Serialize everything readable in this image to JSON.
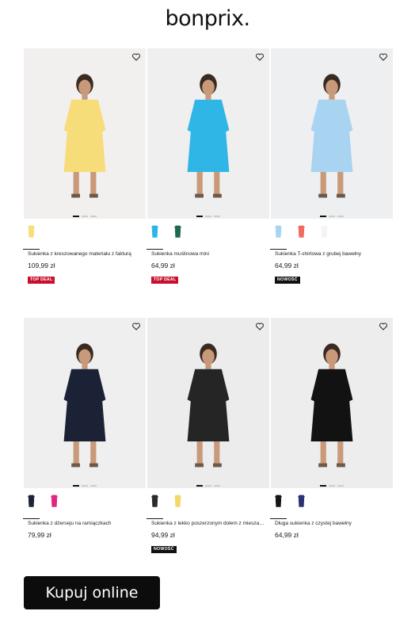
{
  "brand": {
    "logo_text": "bonprix."
  },
  "products": [
    {
      "name": "Sukienka z kreszowanego materiału z fakturą",
      "price": "109,99 zł",
      "badge": "TOP DEAL",
      "badge_type": "top",
      "photo_bg": "#f2f0ee",
      "swatch_colors": [
        "#f6de7a"
      ],
      "dress_color": "#f7dc7a",
      "icon": "dress-photo-yellow-floral"
    },
    {
      "name": "Sukienka muślinowa mini",
      "price": "64,99 zł",
      "badge": "TOP DEAL",
      "badge_type": "top",
      "photo_bg": "#efefef",
      "swatch_colors": [
        "#2ab7e6",
        "#1c6a4e"
      ],
      "dress_color": "#2fb6e6",
      "icon": "dress-photo-blue"
    },
    {
      "name": "Sukienka T-shirtowa z grubej bawełny",
      "price": "64,99 zł",
      "badge": "NOWOŚĆ",
      "badge_type": "new",
      "photo_bg": "#eeeff0",
      "swatch_colors": [
        "#a9d4f1",
        "#f06a5e",
        "#f4f4f4"
      ],
      "dress_color": "#a8d3f1",
      "icon": "dress-photo-light-blue"
    },
    {
      "name": "Sukienka z dżerseju na ramiączkach",
      "price": "79,99 zł",
      "badge": "",
      "badge_type": "",
      "photo_bg": "#efefef",
      "swatch_colors": [
        "#1e2438",
        "#e0287f"
      ],
      "dress_color": "#1c2236",
      "icon": "dress-photo-navy-print"
    },
    {
      "name": "Sukienka z lekko poszerzonym dołem z miesza…",
      "price": "94,99 zł",
      "badge": "NOWOŚĆ",
      "badge_type": "new",
      "photo_bg": "#ececec",
      "swatch_colors": [
        "#2a2a2a",
        "#f4d86a"
      ],
      "dress_color": "#252525",
      "icon": "dress-photo-black-midi"
    },
    {
      "name": "Długa sukienka z czystej bawełny",
      "price": "64,99 zł",
      "badge": "",
      "badge_type": "",
      "photo_bg": "#ededed",
      "swatch_colors": [
        "#151515",
        "#2a3275"
      ],
      "dress_color": "#121212",
      "icon": "dress-photo-black-maxi"
    }
  ],
  "cta": {
    "label": "Kupuj online"
  }
}
